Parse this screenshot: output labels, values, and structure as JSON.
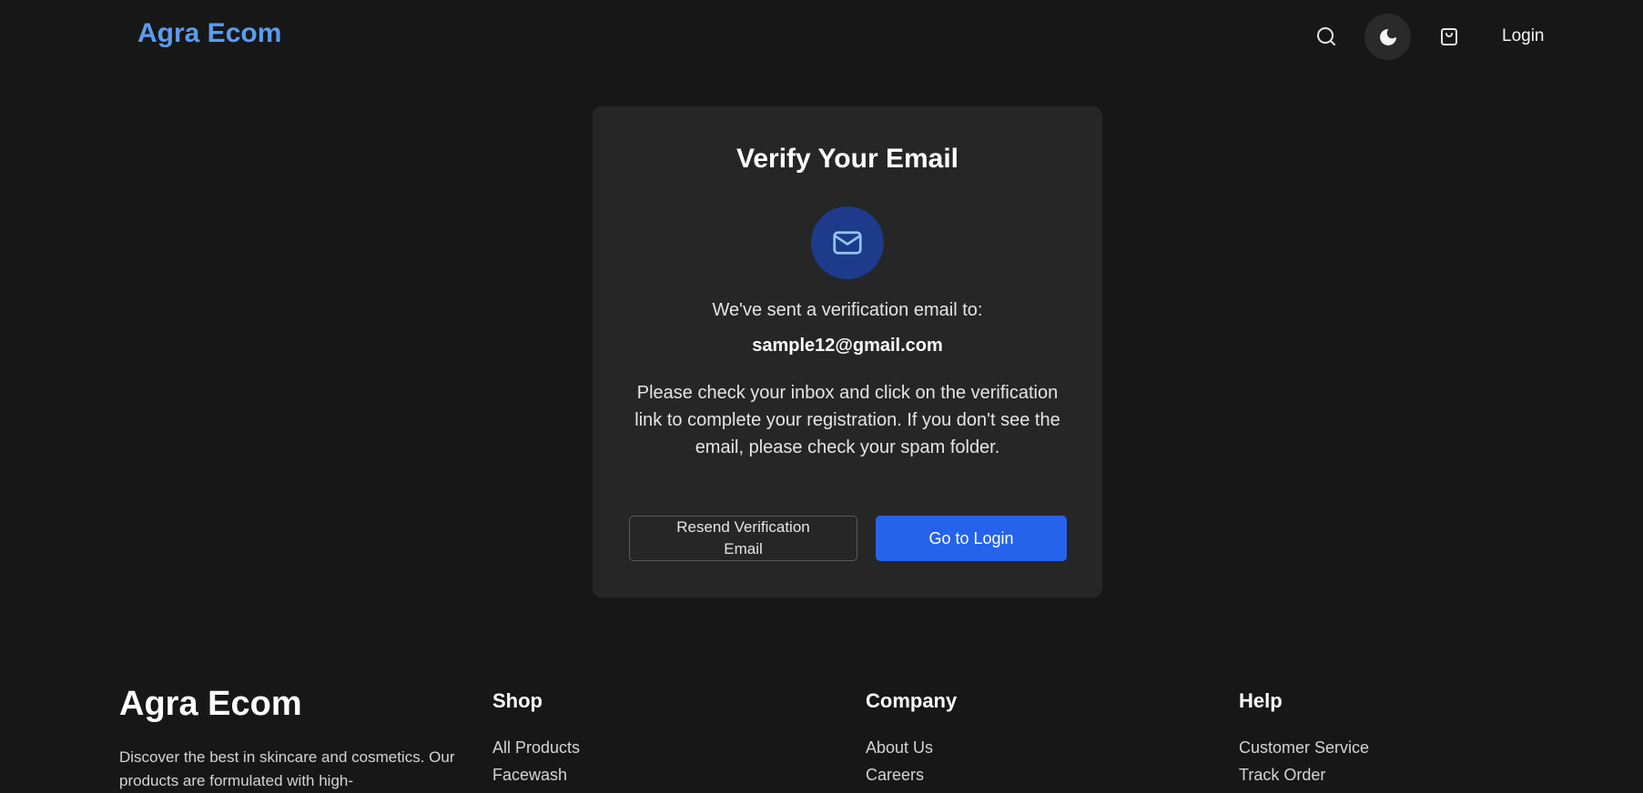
{
  "header": {
    "brand": "Agra Ecom",
    "login_label": "Login",
    "icons": [
      "search-icon",
      "moon-icon",
      "shopping-bag-icon"
    ]
  },
  "card": {
    "title": "Verify Your Email",
    "icon": "mail-icon",
    "sent_text": "We've sent a verification email to:",
    "email": "sample12@gmail.com",
    "instructions": "Please check your inbox and click on the verification link to complete your registration. If you don't see the email, please check your spam folder.",
    "resend_label": "Resend Verification Email",
    "login_label": "Go to Login"
  },
  "footer": {
    "brand": "Agra Ecom",
    "description": "Discover the best in skincare and cosmetics. Our products are formulated with high-",
    "columns": [
      {
        "title": "Shop",
        "items": [
          "All Products",
          "Facewash"
        ]
      },
      {
        "title": "Company",
        "items": [
          "About Us",
          "Careers"
        ]
      },
      {
        "title": "Help",
        "items": [
          "Customer Service",
          "Track Order"
        ]
      }
    ]
  },
  "colors": {
    "background": "#171717",
    "card": "#262626",
    "brand": "#5b9cf0",
    "primary": "#2563eb",
    "icon_circle": "#1e3a8a"
  }
}
